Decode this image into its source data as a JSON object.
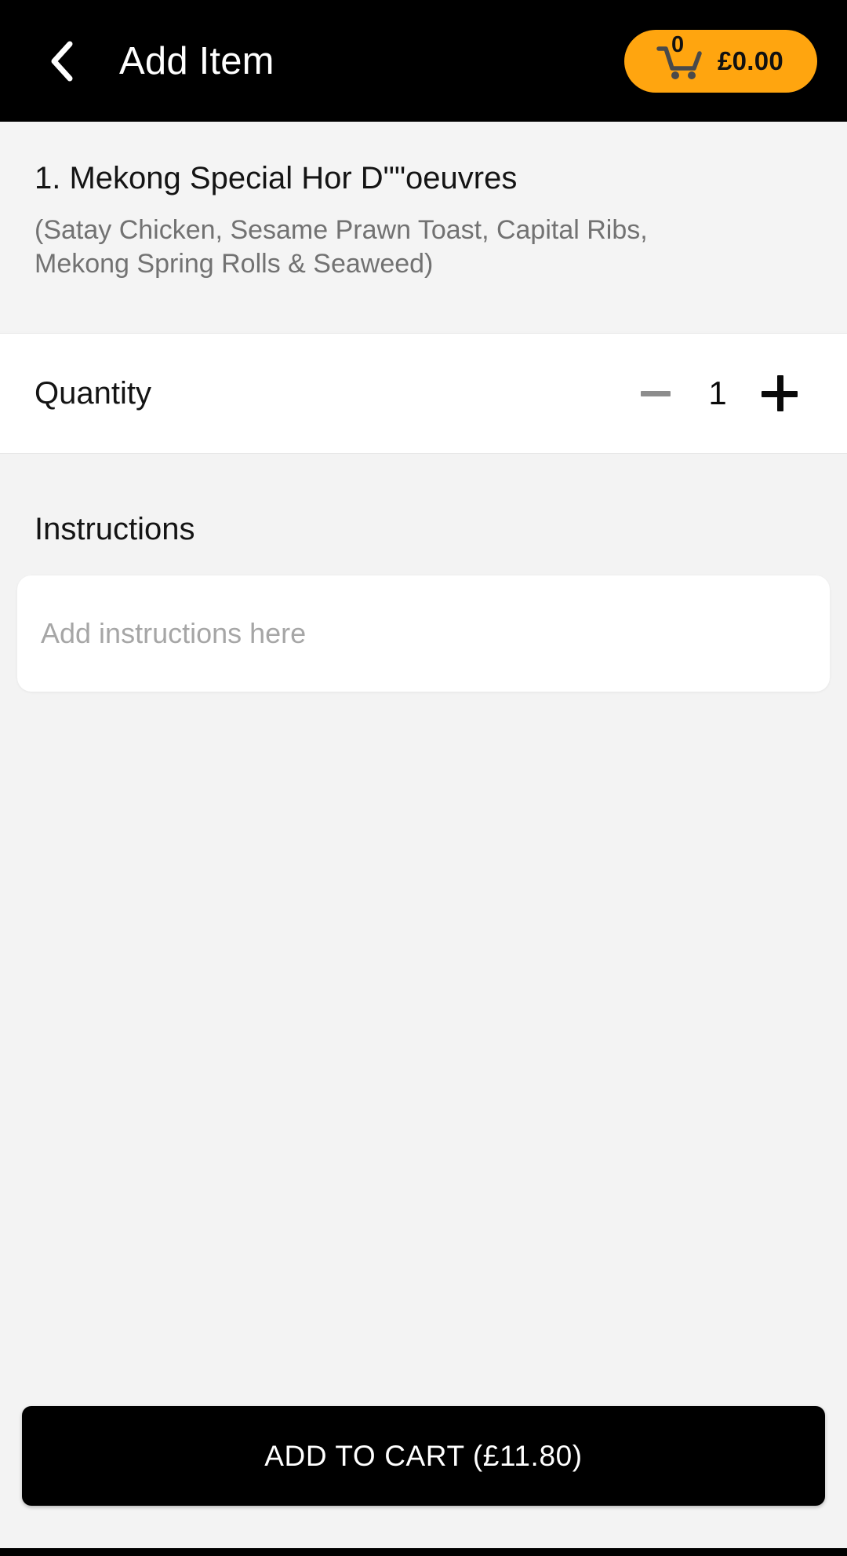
{
  "header": {
    "back_icon": "chevron-left-icon",
    "title": "Add Item",
    "cart": {
      "icon": "shopping-cart-icon",
      "badge_count": "0",
      "total": "£0.00",
      "background": "#ffa50f"
    }
  },
  "item": {
    "title": "1. Mekong Special Hor D\"\"oeuvres",
    "description": "(Satay Chicken, Sesame Prawn Toast, Capital Ribs, Mekong Spring Rolls & Seaweed)"
  },
  "quantity": {
    "label": "Quantity",
    "value": "1",
    "minus_icon": "minus-icon",
    "plus_icon": "plus-icon",
    "minus_enabled": false,
    "plus_enabled": true
  },
  "instructions": {
    "label": "Instructions",
    "value": "",
    "placeholder": "Add instructions here"
  },
  "cta": {
    "label": "ADD TO CART  (£11.80)",
    "background": "#000000",
    "text_color": "#ffffff"
  }
}
